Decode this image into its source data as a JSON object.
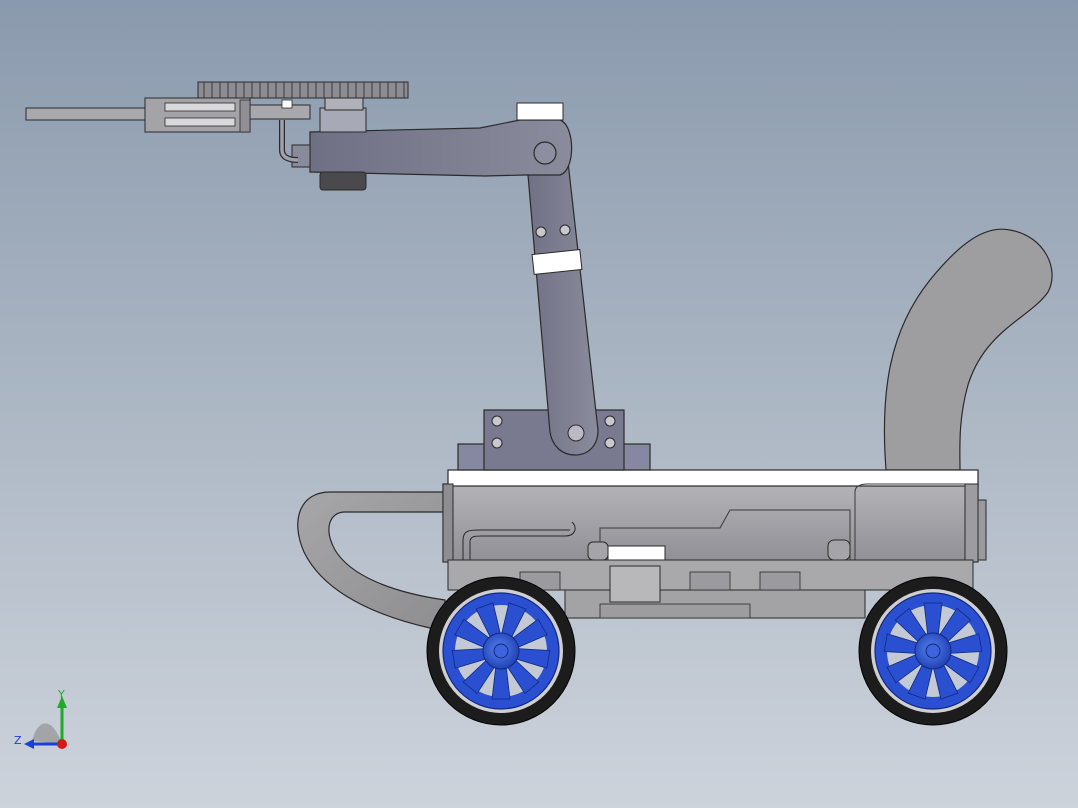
{
  "scene": {
    "model": "robot-car-with-arm",
    "view": "side",
    "colors": {
      "background_top": "#8a9aad",
      "background_bottom": "#cdd3db",
      "body_gray": "#9c9ca2",
      "arm_gray": "#7a7b8e",
      "wheel_blue": "#2a4fd0",
      "tire_black": "#1c1c1c",
      "edge_dark": "#2a2a2a"
    }
  },
  "triad": {
    "y_label": "Y",
    "z_label": "Z",
    "y_color": "#1faa2a",
    "z_color": "#1a3fd6",
    "x_color": "#d61a1a"
  }
}
